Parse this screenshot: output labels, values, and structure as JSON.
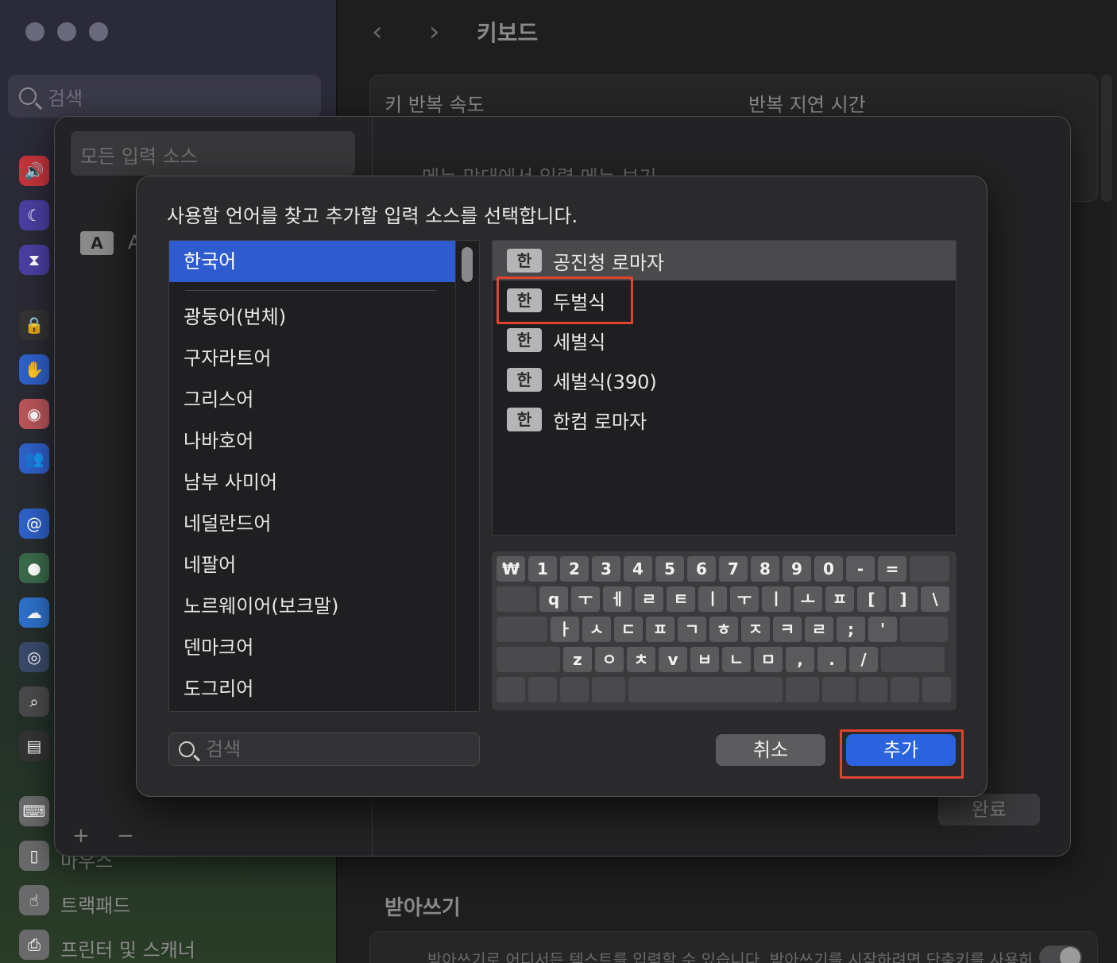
{
  "window": {
    "title": "키보드",
    "search_placeholder": "검색"
  },
  "background": {
    "key_repeat_label": "키 반복 속도",
    "repeat_delay_label": "반복 지연 시간",
    "menu_bar_label": "메뉴 막대에서 입력 메뉴 보기",
    "dictation_heading": "받아쓰기",
    "dictation_desc": "받아쓰기로 어디서든 텍스트를 입력할 수 있습니다. 받아쓰기를 시작하려면 단축키를 사용하거나",
    "sidebar_items": [
      "마우스",
      "트랙패드",
      "프린터 및 스캐너"
    ]
  },
  "input_sources_sheet": {
    "selected_filter": "모든 입력 소스",
    "source_badge": "A",
    "source_label": "A",
    "add_symbol": "+",
    "remove_symbol": "−",
    "done_label": "완료"
  },
  "dialog": {
    "instruction": "사용할 언어를 찾고 추가할 입력 소스를 선택합니다.",
    "languages": [
      "한국어",
      "광둥어(번체)",
      "구자라트어",
      "그리스어",
      "나바호어",
      "남부 사미어",
      "네덜란드어",
      "네팔어",
      "노르웨이어(보크말)",
      "덴마크어",
      "도그리어"
    ],
    "selected_language": "한국어",
    "sources": [
      {
        "badge": "한",
        "label": "공진청 로마자",
        "selected": true
      },
      {
        "badge": "한",
        "label": "두벌식",
        "selected": false
      },
      {
        "badge": "한",
        "label": "세벌식",
        "selected": false
      },
      {
        "badge": "한",
        "label": "세벌식(390)",
        "selected": false
      },
      {
        "badge": "한",
        "label": "한컴 로마자",
        "selected": false
      }
    ],
    "keyboard_rows": [
      [
        "₩",
        "1",
        "2",
        "3",
        "4",
        "5",
        "6",
        "7",
        "8",
        "9",
        "0",
        "-",
        "="
      ],
      [
        "q",
        "ㅜ",
        "ㅔ",
        "ㄹ",
        "ㅌ",
        "ㅣ",
        "ㅜ",
        "ㅣ",
        "ㅗ",
        "ㅍ",
        "[",
        "]",
        "\\"
      ],
      [
        "ㅏ",
        "ㅅ",
        "ㄷ",
        "ㅍ",
        "ㄱ",
        "ㅎ",
        "ㅈ",
        "ㅋ",
        "ㄹ",
        ";",
        "'"
      ],
      [
        "z",
        "ㅇ",
        "ㅊ",
        "v",
        "ㅂ",
        "ㄴ",
        "ㅁ",
        ",",
        ".",
        "/"
      ]
    ],
    "search_placeholder": "검색",
    "cancel_label": "취소",
    "add_label": "추가",
    "highlight_color": "#e0432f",
    "accent_color": "#2f5bd0"
  }
}
